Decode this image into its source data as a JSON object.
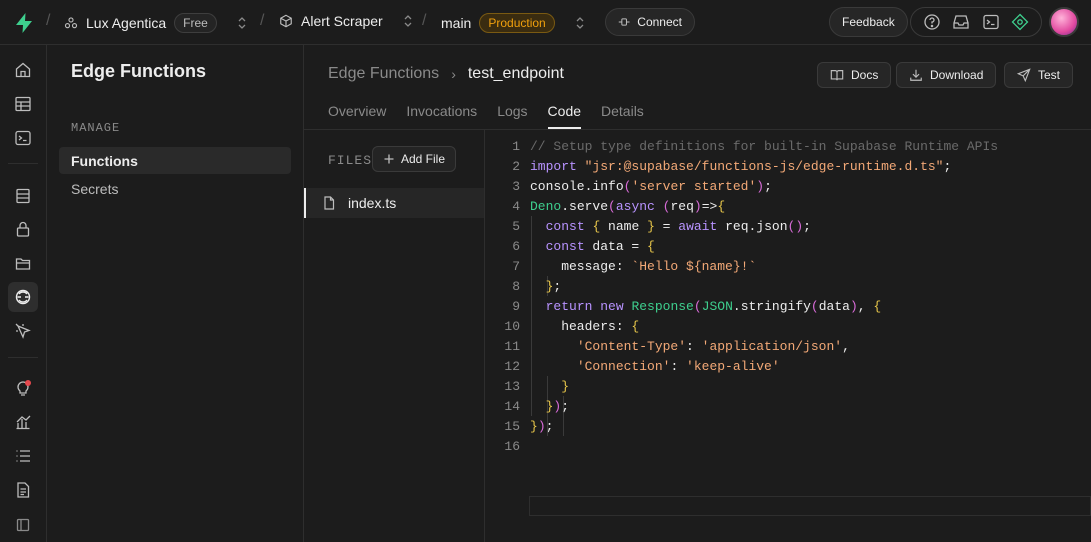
{
  "topbar": {
    "org_name": "Lux Agentica",
    "org_plan": "Free",
    "project_name": "Alert Scraper",
    "branch_name": "main",
    "branch_env": "Production",
    "connect_label": "Connect",
    "feedback_label": "Feedback",
    "separator": "/"
  },
  "sidebar": {
    "title": "Edge Functions",
    "section_heading": "MANAGE",
    "items": [
      {
        "label": "Functions",
        "active": true
      },
      {
        "label": "Secrets",
        "active": false
      }
    ]
  },
  "main": {
    "breadcrumb_parent": "Edge Functions",
    "breadcrumb_current": "test_endpoint",
    "breadcrumb_chevron": "›",
    "docs_label": "Docs",
    "download_label": "Download",
    "test_label": "Test",
    "tabs": [
      {
        "label": "Overview",
        "active": false
      },
      {
        "label": "Invocations",
        "active": false
      },
      {
        "label": "Logs",
        "active": false
      },
      {
        "label": "Code",
        "active": true
      },
      {
        "label": "Details",
        "active": false
      }
    ],
    "files_label": "FILES",
    "add_file_label": "Add File",
    "files": [
      {
        "name": "index.ts",
        "active": true
      }
    ]
  },
  "editor": {
    "line_numbers": [
      "1",
      "2",
      "3",
      "4",
      "5",
      "6",
      "7",
      "8",
      "9",
      "10",
      "11",
      "12",
      "13",
      "14",
      "15",
      "16"
    ],
    "lines": [
      "// Setup type definitions for built-in Supabase Runtime APIs",
      "import \"jsr:@supabase/functions-js/edge-runtime.d.ts\";",
      "console.info('server started');",
      "Deno.serve(async (req)=>{",
      "  const { name } = await req.json();",
      "  const data = {",
      "    message: `Hello ${name}!`",
      "  };",
      "  return new Response(JSON.stringify(data), {",
      "    headers: {",
      "      'Content-Type': 'application/json',",
      "      'Connection': 'keep-alive'",
      "    }",
      "  });",
      "});",
      ""
    ]
  },
  "colors": {
    "accent": "#3ecf8e",
    "production": "#f1a10d",
    "background": "#1c1c1c",
    "border": "#2e2e2e"
  },
  "icons": {
    "logo": "supabase-bolt-icon",
    "rail": [
      "home-icon",
      "table-editor-icon",
      "sql-editor-icon",
      "database-icon",
      "auth-lock-icon",
      "storage-icon",
      "edge-functions-icon",
      "realtime-icon",
      "advisors-icon",
      "reports-icon",
      "logs-icon",
      "docs-icon",
      "collapse-icon"
    ],
    "topbar": [
      "help-icon",
      "inbox-icon",
      "terminal-icon",
      "assistant-icon"
    ]
  }
}
